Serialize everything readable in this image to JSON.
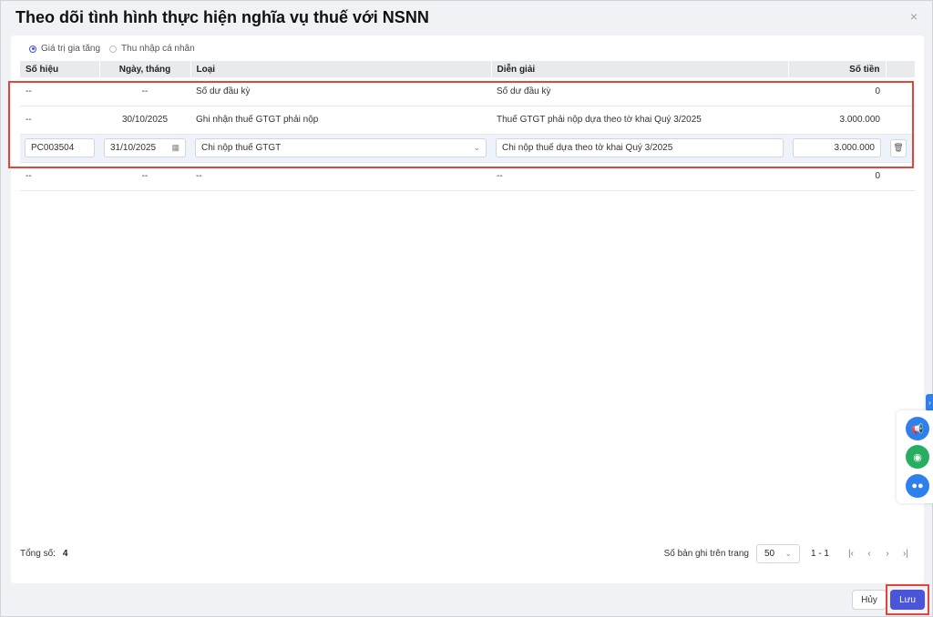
{
  "dialog": {
    "title": "Theo dõi tình hình thực hiện nghĩa vụ thuế với NSNN",
    "close_glyph": "×"
  },
  "tax_type": {
    "options": [
      {
        "label": "Giá trị gia tăng",
        "selected": true
      },
      {
        "label": "Thu nhập cá nhân",
        "selected": false
      }
    ]
  },
  "table": {
    "headers": {
      "so_hieu": "Số hiệu",
      "ngay_thang": "Ngày, tháng",
      "loai": "Loại",
      "dien_giai": "Diễn giải",
      "so_tien": "Số tiền"
    },
    "rows": [
      {
        "so_hieu": "--",
        "ngay_thang": "--",
        "loai": "Số dư đầu kỳ",
        "dien_giai": "Số dư đầu kỳ",
        "so_tien": "0"
      },
      {
        "so_hieu": "--",
        "ngay_thang": "30/10/2025",
        "loai": "Ghi nhận thuế GTGT phải nộp",
        "dien_giai": "Thuế GTGT phải nộp dựa theo tờ khai Quý 3/2025",
        "so_tien": "3.000.000"
      },
      {
        "so_hieu": "--",
        "ngay_thang": "--",
        "loai": "--",
        "dien_giai": "--",
        "so_tien": "0"
      }
    ],
    "edit_row": {
      "so_hieu": "PC003504",
      "ngay_thang": "31/10/2025",
      "loai": "Chi nộp thuế GTGT",
      "dien_giai": "Chi nộp thuế dựa theo tờ khai Quý 3/2025",
      "so_tien": "3.000.000"
    }
  },
  "footer": {
    "total_label": "Tổng số:",
    "total_value": "4",
    "per_page_label": "Số bản ghi trên trang",
    "per_page_value": "50",
    "range": "1 - 1"
  },
  "actions": {
    "cancel": "Hủy",
    "save": "Lưu"
  },
  "side_widgets": [
    "megaphone-icon",
    "chat-icon",
    "robot-icon"
  ],
  "colors": {
    "accent": "#4a55d8",
    "highlight": "#e2453a",
    "widget_blue": "#2f80ed",
    "widget_green": "#27ae60"
  }
}
